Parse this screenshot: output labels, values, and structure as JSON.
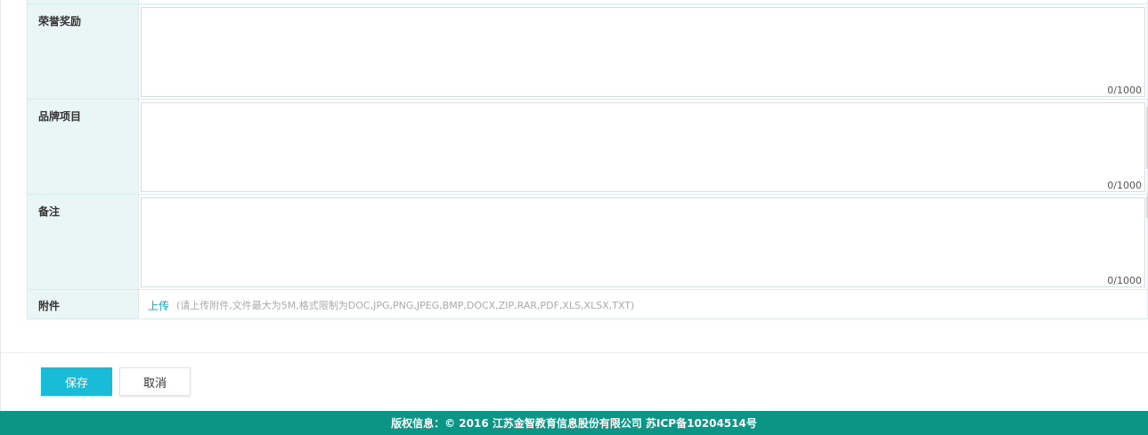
{
  "form": {
    "rows": [
      {
        "label": "荣誉奖励",
        "value": "",
        "counter": "0/1000"
      },
      {
        "label": "品牌项目",
        "value": "",
        "counter": "0/1000"
      },
      {
        "label": "备注",
        "value": "",
        "counter": "0/1000"
      }
    ],
    "attachment": {
      "label": "附件",
      "upload_label": "上传",
      "hint": "(请上传附件,文件最大为5M,格式限制为DOC,JPG,PNG,JPEG,BMP,DOCX,ZIP,RAR,PDF,XLS,XLSX,TXT)"
    }
  },
  "actions": {
    "save_label": "保存",
    "cancel_label": "取消"
  },
  "footer": {
    "copyright": "版权信息：© 2016 江苏金智教育信息股份有限公司 苏ICP备10204514号"
  },
  "colors": {
    "accent": "#19bcd6",
    "footer_bg": "#0b9585",
    "label_bg": "#eaf6f5",
    "link": "#1aa3c6"
  }
}
